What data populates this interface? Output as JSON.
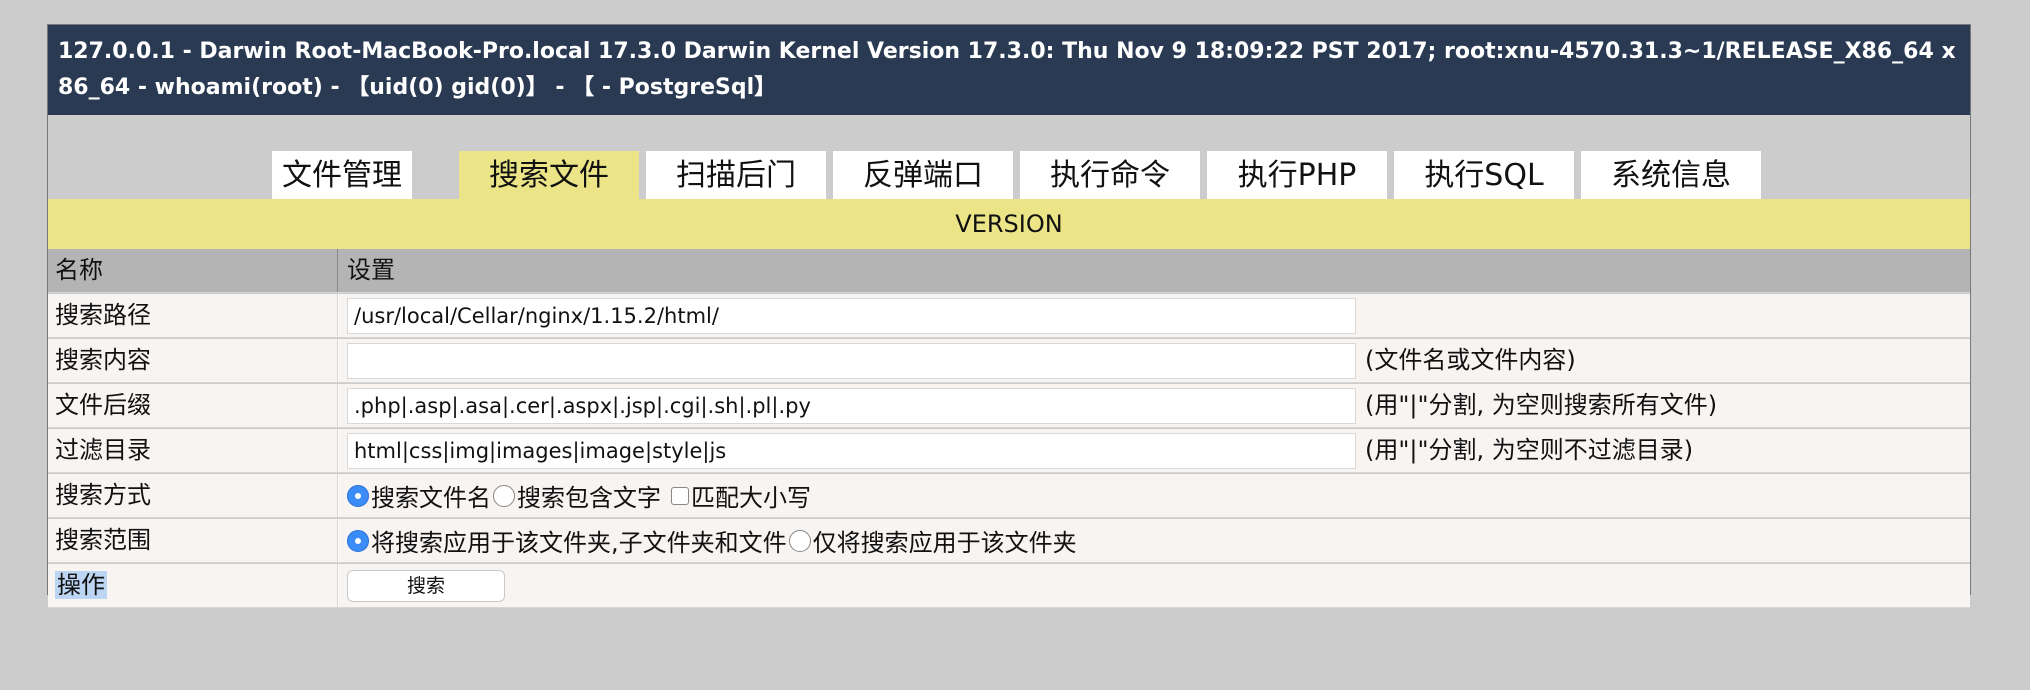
{
  "header": {
    "title": "127.0.0.1 - Darwin Root-MacBook-Pro.local 17.3.0 Darwin Kernel Version 17.3.0: Thu Nov 9 18:09:22 PST 2017; root:xnu-4570.31.3~1/RELEASE_X86_64 x86_64 - whoami(root) - 【uid(0) gid(0)】 - 【 - PostgreSql】"
  },
  "tabs": [
    {
      "label": "文件管理",
      "active": false
    },
    {
      "label": "搜索文件",
      "active": true
    },
    {
      "label": "扫描后门",
      "active": false
    },
    {
      "label": "反弹端口",
      "active": false
    },
    {
      "label": "执行命令",
      "active": false
    },
    {
      "label": "执行PHP",
      "active": false
    },
    {
      "label": "执行SQL",
      "active": false
    },
    {
      "label": "系统信息",
      "active": false
    }
  ],
  "version_bar": "VERSION",
  "table": {
    "col_name": "名称",
    "col_setting": "设置",
    "rows": {
      "path": {
        "label": "搜索路径",
        "value": "/usr/local/Cellar/nginx/1.15.2/html/",
        "hint": ""
      },
      "content": {
        "label": "搜索内容",
        "value": "",
        "hint": "(文件名或文件内容)"
      },
      "ext": {
        "label": "文件后缀",
        "value": ".php|.asp|.asa|.cer|.aspx|.jsp|.cgi|.sh|.pl|.py",
        "hint": "(用\"|\"分割, 为空则搜索所有文件)"
      },
      "filter": {
        "label": "过滤目录",
        "value": "html|css|img|images|image|style|js",
        "hint": "(用\"|\"分割, 为空则不过滤目录)"
      },
      "method": {
        "label": "搜索方式",
        "opt1": "搜索文件名",
        "opt2": "搜索包含文字",
        "check": "匹配大小写"
      },
      "scope": {
        "label": "搜索范围",
        "opt1": "将搜索应用于该文件夹,子文件夹和文件",
        "opt2": "仅将搜索应用于该文件夹"
      },
      "action": {
        "label": "操作",
        "button": "搜索"
      }
    }
  },
  "colors": {
    "header_bg": "#293a52",
    "tab_active": "#ebe587",
    "radio_on": "#3b8cf6"
  }
}
